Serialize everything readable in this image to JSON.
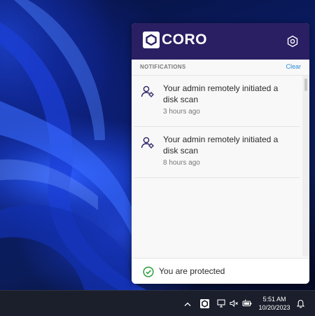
{
  "app": {
    "logo_text": "CORO",
    "brand_color": "#2a1f63",
    "accent_color": "#2b8ad8",
    "settings_icon": "settings-hexagon-icon"
  },
  "notifications": {
    "title": "NOTIFICATIONS",
    "clear_label": "Clear",
    "items": [
      {
        "icon": "user-gear-icon",
        "message": "Your admin remotely initiated a disk scan",
        "time": "3 hours ago"
      },
      {
        "icon": "user-gear-icon",
        "message": "Your admin remotely initiated a disk scan",
        "time": "8 hours ago"
      }
    ]
  },
  "status": {
    "icon": "check-circle-icon",
    "text": "You are protected",
    "color": "#2e9e3c"
  },
  "taskbar": {
    "icons": [
      "chevron-up-icon",
      "coro-tray-icon",
      "network-icon",
      "speaker-muted-icon",
      "battery-icon",
      "bell-icon"
    ],
    "time": "5:51 AM",
    "date": "10/20/2023"
  }
}
